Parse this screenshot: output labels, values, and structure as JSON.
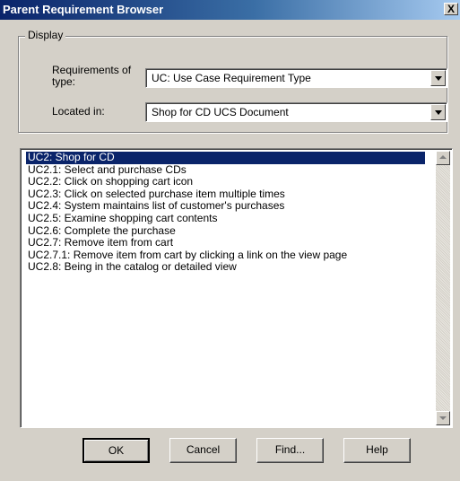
{
  "window": {
    "title": "Parent Requirement Browser",
    "close_label": "X"
  },
  "display": {
    "legend": "Display",
    "type_label": "Requirements of type:",
    "type_value": "UC: Use Case Requirement Type",
    "location_label": "Located in:",
    "location_value": "Shop for CD UCS Document"
  },
  "requirements": {
    "selected_index": 0,
    "items": [
      "UC2: Shop for CD",
      "UC2.1: Select and purchase CDs",
      "UC2.2: Click on shopping cart icon",
      "UC2.3: Click on selected purchase item multiple times",
      "UC2.4: System maintains list of customer's purchases",
      "UC2.5: Examine shopping cart contents",
      "UC2.6: Complete the purchase",
      "UC2.7: Remove item from cart",
      "UC2.7.1: Remove item from cart by clicking a link on the view page",
      "UC2.8: Being in the catalog or detailed view"
    ]
  },
  "buttons": {
    "ok": "OK",
    "cancel": "Cancel",
    "find": "Find...",
    "help": "Help"
  },
  "colors": {
    "title_active": "#0a246a",
    "selection": "#0a246a",
    "face": "#d4d0c8"
  }
}
